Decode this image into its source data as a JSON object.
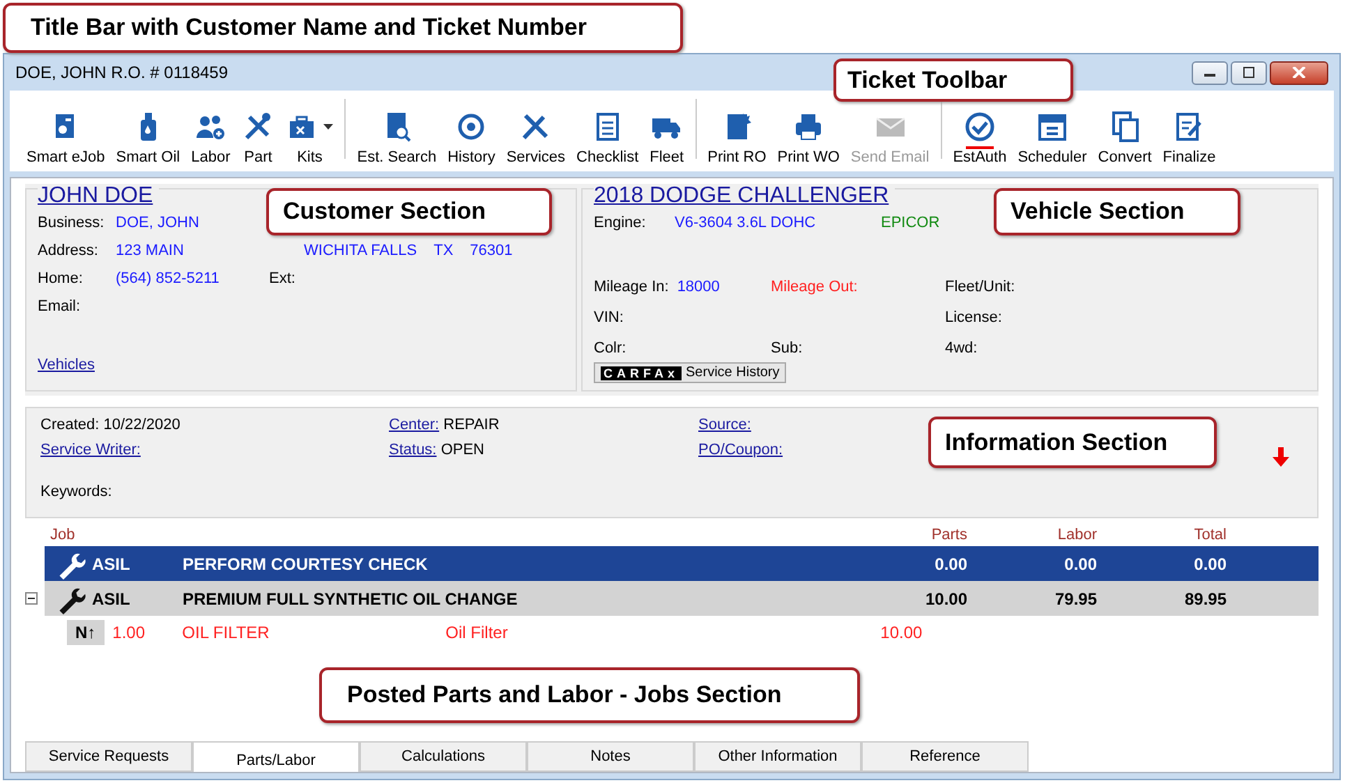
{
  "annotations": [
    {
      "text": "Title Bar with Customer Name and Ticket Number"
    },
    {
      "text": "Ticket Toolbar"
    },
    {
      "text": "Customer Section"
    },
    {
      "text": "Vehicle Section"
    },
    {
      "text": "Information Section"
    },
    {
      "text": "Posted Parts and Labor - Jobs Section"
    }
  ],
  "window": {
    "title": "DOE, JOHN R.O. # 0118459"
  },
  "toolbar": [
    [
      {
        "label": "Smart eJob",
        "disabled": false,
        "dropdown": false,
        "highlighted": false
      },
      {
        "label": "Smart Oil",
        "disabled": false,
        "dropdown": false,
        "highlighted": false
      },
      {
        "label": "Labor",
        "disabled": false,
        "dropdown": false,
        "highlighted": false
      },
      {
        "label": "Part",
        "disabled": false,
        "dropdown": false,
        "highlighted": false
      },
      {
        "label": "Kits",
        "disabled": false,
        "dropdown": true,
        "highlighted": false
      }
    ],
    [
      {
        "label": "Est. Search",
        "disabled": false,
        "dropdown": false,
        "highlighted": false
      },
      {
        "label": "History",
        "disabled": false,
        "dropdown": false,
        "highlighted": false
      },
      {
        "label": "Services",
        "disabled": false,
        "dropdown": false,
        "highlighted": false
      },
      {
        "label": "Checklist",
        "disabled": false,
        "dropdown": false,
        "highlighted": false
      },
      {
        "label": "Fleet",
        "disabled": false,
        "dropdown": false,
        "highlighted": false
      }
    ],
    [
      {
        "label": "Print RO",
        "disabled": false,
        "dropdown": false,
        "highlighted": false
      },
      {
        "label": "Print WO",
        "disabled": false,
        "dropdown": false,
        "highlighted": false
      },
      {
        "label": "Send Email",
        "disabled": true,
        "dropdown": false,
        "highlighted": false
      }
    ],
    [
      {
        "label": "EstAuth",
        "disabled": false,
        "dropdown": false,
        "highlighted": true
      },
      {
        "label": "Scheduler",
        "disabled": false,
        "dropdown": false,
        "highlighted": false
      },
      {
        "label": "Convert",
        "disabled": false,
        "dropdown": false,
        "highlighted": false
      },
      {
        "label": "Finalize",
        "disabled": false,
        "dropdown": false,
        "highlighted": false
      }
    ]
  ],
  "customer": {
    "name": "JOHN DOE",
    "business_label": "Business:",
    "business": "DOE, JOHN",
    "address_label": "Address:",
    "address": "123 MAIN",
    "city": "WICHITA FALLS",
    "state": "TX",
    "zip": "76301",
    "home_label": "Home:",
    "home": "(564) 852-5211",
    "ext_label": "Ext:",
    "email_label": "Email:",
    "vehicles_link": "Vehicles"
  },
  "vehicle": {
    "title": "2018 DODGE CHALLENGER",
    "engine_label": "Engine:",
    "engine": "V6-3604 3.6L DOHC",
    "source": "EPICOR",
    "mileage_in_label": "Mileage In:",
    "mileage_in": "18000",
    "mileage_out_label": "Mileage Out:",
    "fleet_label": "Fleet/Unit:",
    "vin_label": "VIN:",
    "license_label": "License:",
    "color_label": "Colr:",
    "sub_label": "Sub:",
    "wd_label": "4wd:",
    "carfax_logo": "CARFAx",
    "carfax_text": "Service History"
  },
  "information": {
    "created_label": "Created:",
    "created": "10/22/2020",
    "service_writer_label": "Service Writer:",
    "keywords_label": "Keywords:",
    "center_label": "Center:",
    "center": "REPAIR",
    "status_label": "Status:",
    "status": "OPEN",
    "source_label": "Source:",
    "po_label": "PO/Coupon:"
  },
  "jobs": {
    "columns": [
      "Job",
      "Parts",
      "Labor",
      "Total"
    ],
    "rows": [
      {
        "code": "ASIL",
        "description": "PERFORM COURTESY CHECK",
        "parts": "0.00",
        "labor": "0.00",
        "total": "0.00",
        "selected": true
      },
      {
        "code": "ASIL",
        "description": "PREMIUM FULL SYNTHETIC OIL CHANGE",
        "parts": "10.00",
        "labor": "79.95",
        "total": "89.95",
        "selected": false,
        "expanded": true,
        "children": [
          {
            "badge": "N↑",
            "qty": "1.00",
            "part_number": "OIL FILTER",
            "description": "Oil Filter",
            "price": "10.00"
          }
        ]
      }
    ]
  },
  "tabs": [
    {
      "label": "Service Requests",
      "selected": false
    },
    {
      "label": "Parts/Labor",
      "selected": true
    },
    {
      "label": "Calculations",
      "selected": false
    },
    {
      "label": "Notes",
      "selected": false
    },
    {
      "label": "Other Information",
      "selected": false
    },
    {
      "label": "Reference",
      "selected": false
    }
  ]
}
